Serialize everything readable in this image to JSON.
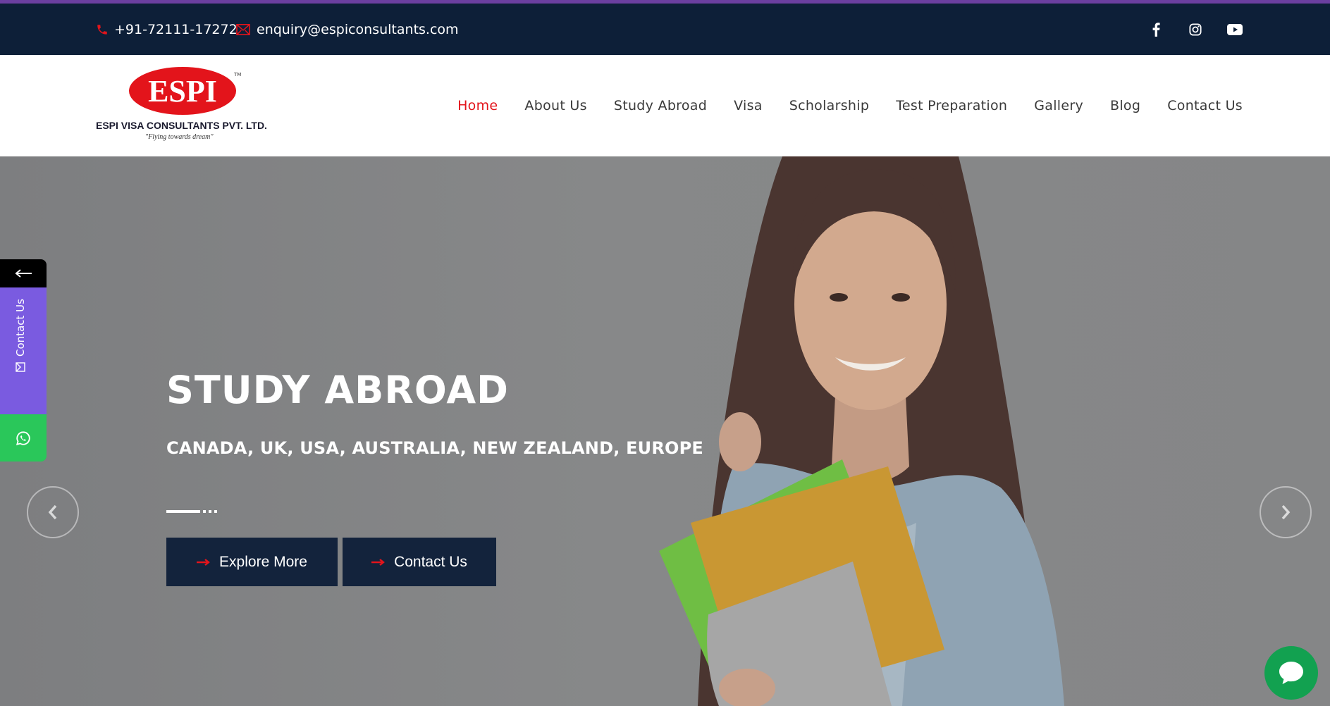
{
  "colors": {
    "accent_line": "#6b3fa0",
    "topbar_bg": "#0d1f38",
    "active_nav": "#e3141b",
    "button_bg": "#13233c",
    "side_contact_bg": "#7a5be0",
    "whatsapp_bg": "#2ac75a",
    "chat_bg": "#12a150"
  },
  "topbar": {
    "phone": "+91-72111-17272",
    "email": "enquiry@espiconsultants.com",
    "phone_icon": "phone-icon",
    "email_icon": "envelope-icon",
    "social": [
      "facebook-icon",
      "instagram-icon",
      "youtube-icon"
    ]
  },
  "logo": {
    "mark": "ESPI",
    "tm": "TM",
    "name": "ESPI VISA CONSULTANTS PVT. LTD.",
    "tagline": "\"Flying towards dream\""
  },
  "nav": {
    "items": [
      {
        "label": "Home",
        "active": true
      },
      {
        "label": "About Us"
      },
      {
        "label": "Study Abroad"
      },
      {
        "label": "Visa"
      },
      {
        "label": "Scholarship"
      },
      {
        "label": "Test Preparation"
      },
      {
        "label": "Gallery"
      },
      {
        "label": "Blog"
      },
      {
        "label": "Contact Us"
      }
    ]
  },
  "hero": {
    "title": "STUDY ABROAD",
    "subtitle": "CANADA, UK, USA, AUSTRALIA, NEW ZEALAND,  EUROPE",
    "buttons": {
      "explore": "Explore More",
      "contact": "Contact Us"
    },
    "prev_icon": "chevron-left-icon",
    "next_icon": "chevron-right-icon"
  },
  "side_widget": {
    "toggle_icon": "arrow-left-icon",
    "contact_label": "Contact Us",
    "whatsapp_icon": "whatsapp-icon"
  },
  "chat": {
    "icon": "chat-bubble-icon"
  }
}
